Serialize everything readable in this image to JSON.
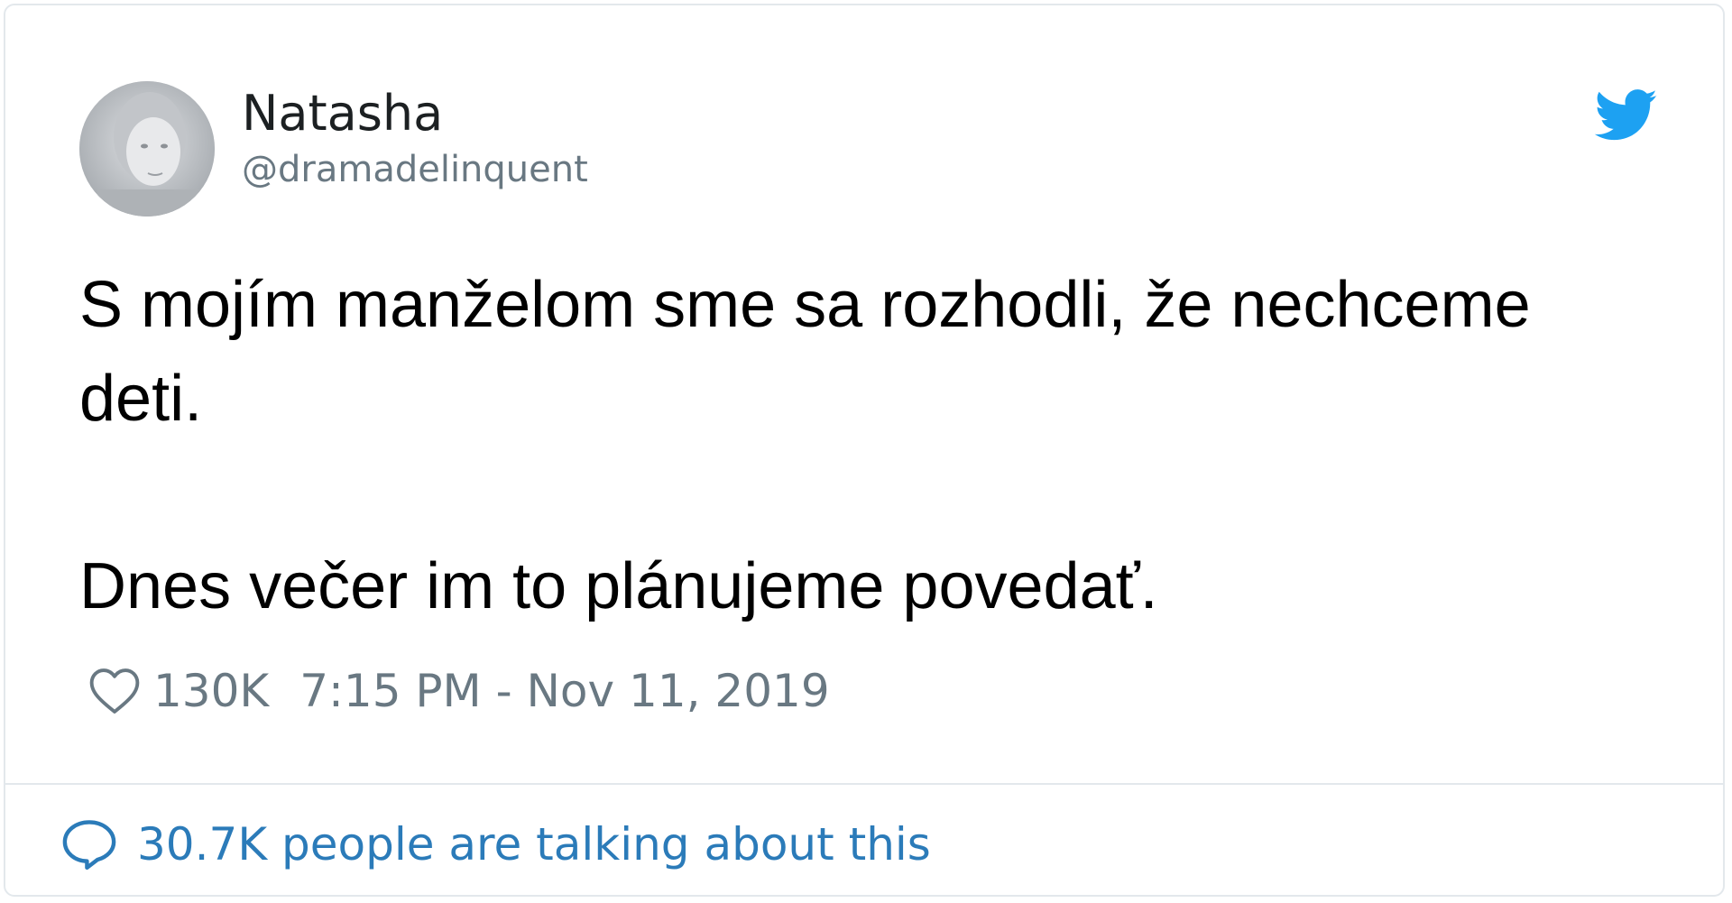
{
  "tweet": {
    "author": {
      "name": "Natasha",
      "handle": "@dramadelinquent",
      "avatar_icon": "user-avatar-photo"
    },
    "brand_icon": "twitter-bird-icon",
    "text_lines": [
      "S mojím manželom sme sa rozhodli, že nechceme",
      "deti.",
      "Dnes večer im to plánujeme povedať."
    ],
    "likes": "130K",
    "timestamp": "7:15 PM - Nov 11, 2019",
    "talking_about": "30.7K people are talking about this"
  },
  "colors": {
    "brand_blue": "#1da1f2",
    "link_blue": "#2b7bb9",
    "muted_gray": "#697882",
    "border": "#e3e8ec"
  }
}
